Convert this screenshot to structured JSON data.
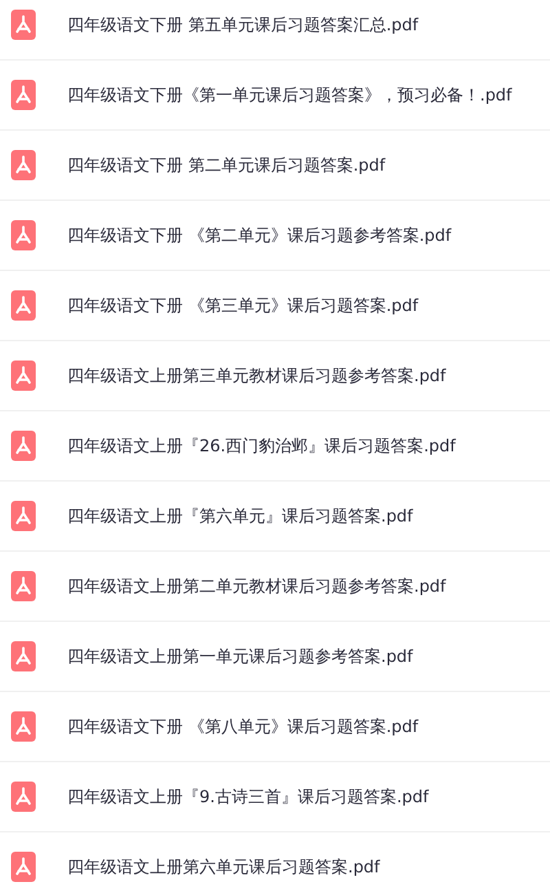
{
  "files": [
    {
      "name": "四年级语文下册 第五单元课后习题答案汇总.pdf"
    },
    {
      "name": "四年级语文下册《第一单元课后习题答案》，预习必备！.pdf"
    },
    {
      "name": "四年级语文下册 第二单元课后习题答案.pdf"
    },
    {
      "name": "四年级语文下册 《第二单元》课后习题参考答案.pdf"
    },
    {
      "name": "四年级语文下册 《第三单元》课后习题答案.pdf"
    },
    {
      "name": "四年级语文上册第三单元教材课后习题参考答案.pdf"
    },
    {
      "name": "四年级语文上册『26.西门豹治邺』课后习题答案.pdf"
    },
    {
      "name": "四年级语文上册『第六单元』课后习题答案.pdf"
    },
    {
      "name": "四年级语文上册第二单元教材课后习题参考答案.pdf"
    },
    {
      "name": "四年级语文上册第一单元课后习题参考答案.pdf"
    },
    {
      "name": "四年级语文下册 《第八单元》课后习题答案.pdf"
    },
    {
      "name": "四年级语文上册『9.古诗三首』课后习题答案.pdf"
    },
    {
      "name": "四年级语文上册第六单元课后习题答案.pdf"
    }
  ]
}
